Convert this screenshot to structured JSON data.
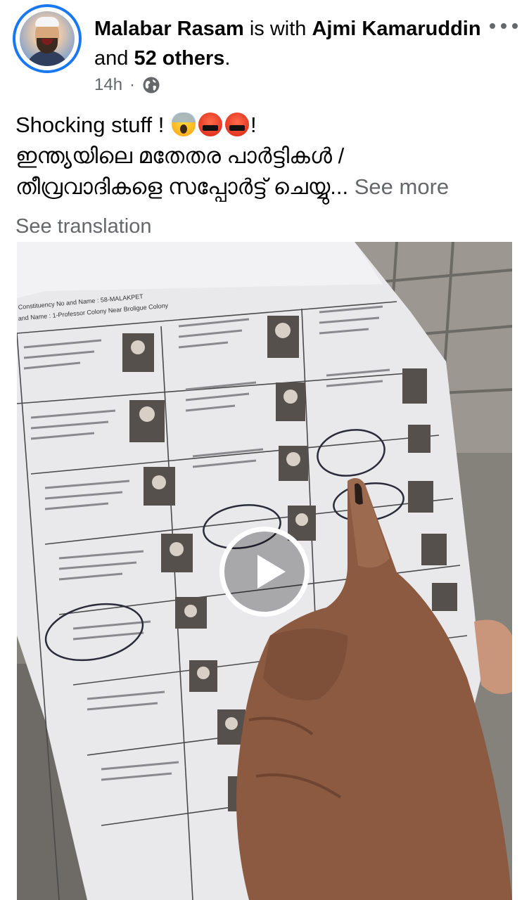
{
  "post": {
    "author": "Malabar Rasam",
    "with_text": "is with",
    "tagged_person": "Ajmi Kamaruddin",
    "and_text": "and",
    "others": "52 others",
    "period": ".",
    "time": "14h",
    "separator": "·",
    "privacy_icon": "globe-icon",
    "more_icon": "more-options-icon"
  },
  "caption": {
    "line1_text": "Shocking stuff !",
    "line1_end": "!",
    "emojis": [
      "face-screaming-emoji",
      "face-with-symbols-on-mouth-emoji",
      "face-with-symbols-on-mouth-emoji"
    ],
    "line2": "ഇന്ത്യയിലെ മതേതര പാർട്ടികൾ /",
    "line3": "തീവ്രവാദികളെ സപ്പോർട്ട് ചെയ്യു...",
    "see_more": "See more",
    "see_translation": "See translation"
  },
  "video": {
    "play_icon": "play-icon",
    "document_header_line1": "Constituency No and Name : 58-MALAKPET",
    "document_header_line2": "and Name : 1-Professor Colony Near Broligue Colony"
  },
  "colors": {
    "accent": "#1877f2",
    "secondary_text": "#65676b",
    "primary_text": "#050505"
  }
}
